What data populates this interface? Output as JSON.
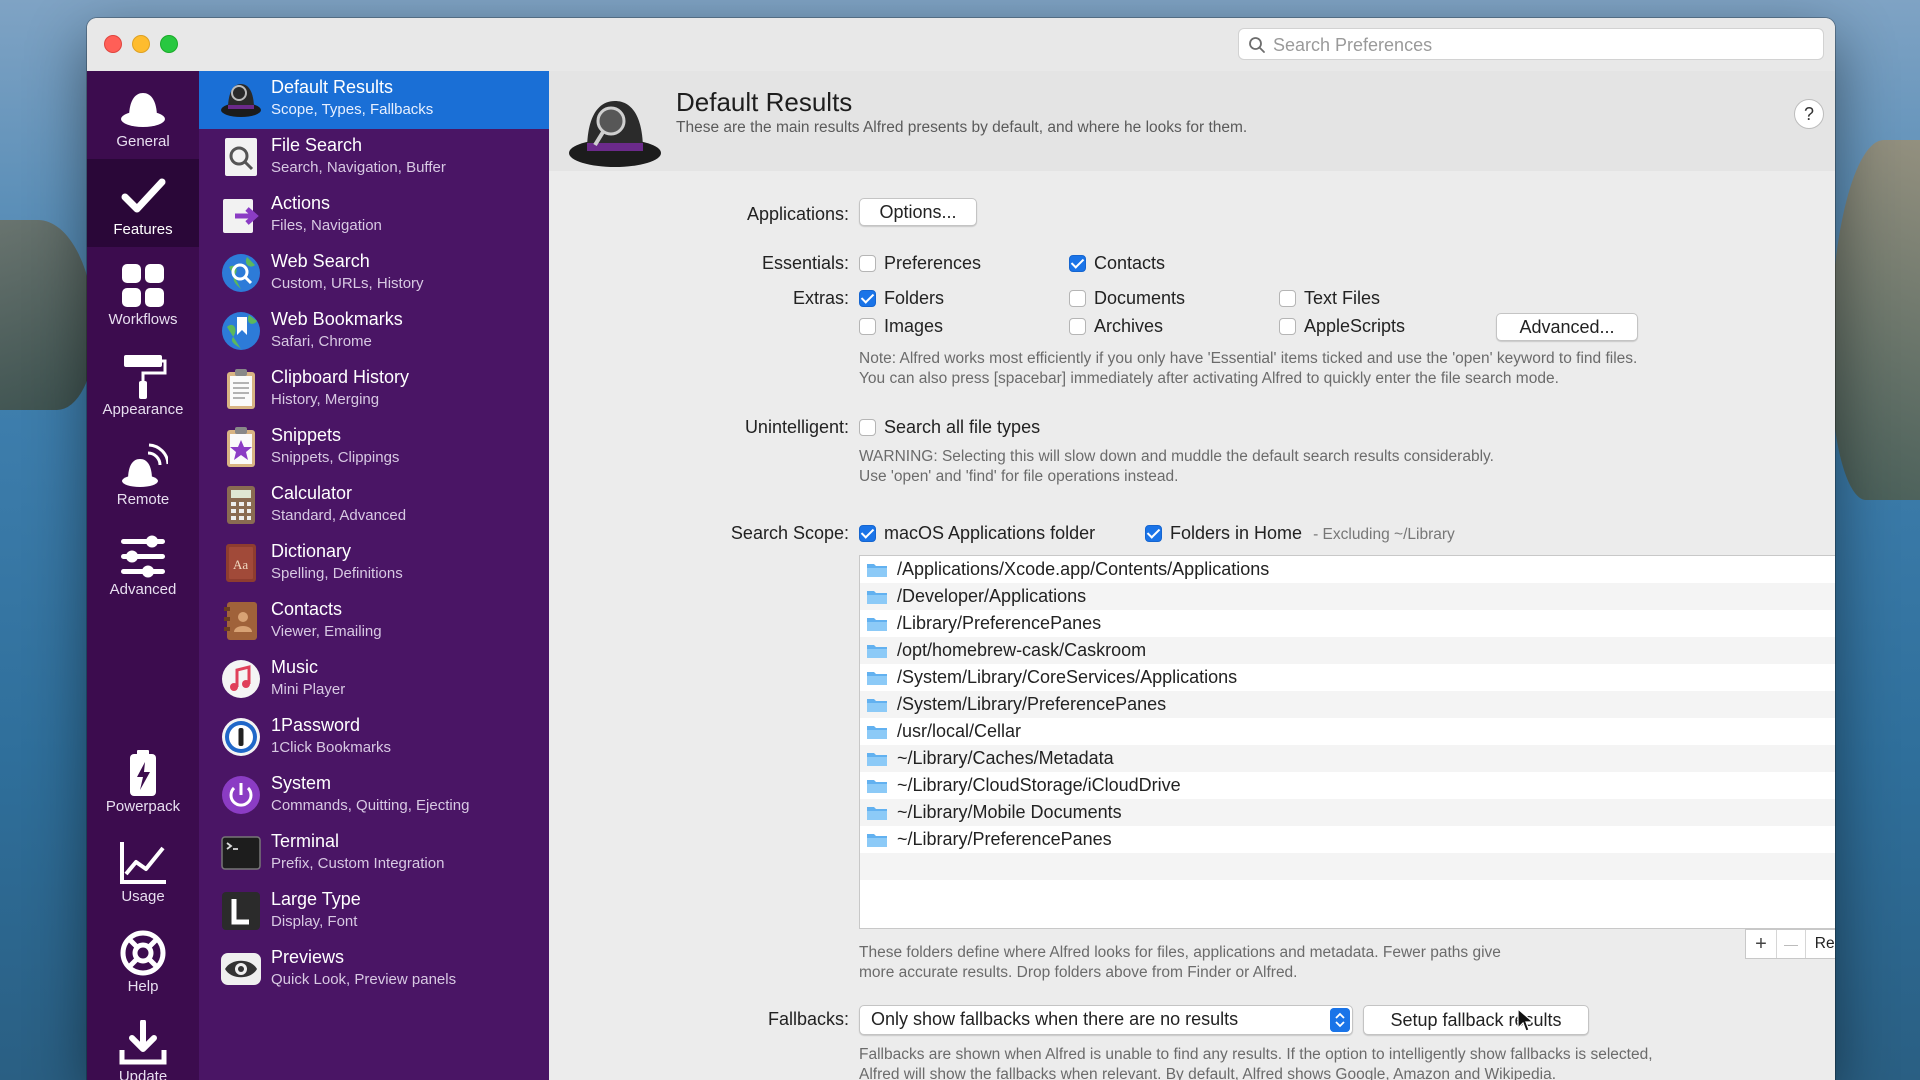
{
  "window": {
    "search_placeholder": "Search Preferences"
  },
  "iconbar": {
    "items": [
      {
        "label": "General",
        "icon": "hat-icon"
      },
      {
        "label": "Features",
        "icon": "checkmark-icon"
      },
      {
        "label": "Workflows",
        "icon": "grid-icon"
      },
      {
        "label": "Appearance",
        "icon": "paint-roller-icon"
      },
      {
        "label": "Remote",
        "icon": "remote-icon"
      },
      {
        "label": "Advanced",
        "icon": "sliders-icon"
      },
      {
        "label": "Powerpack",
        "icon": "powerpack-icon"
      },
      {
        "label": "Usage",
        "icon": "chart-icon"
      },
      {
        "label": "Help",
        "icon": "lifebuoy-icon"
      },
      {
        "label": "Update",
        "icon": "download-icon"
      }
    ]
  },
  "features": [
    {
      "title": "Default Results",
      "subtitle": "Scope, Types, Fallbacks"
    },
    {
      "title": "File Search",
      "subtitle": "Search, Navigation, Buffer"
    },
    {
      "title": "Actions",
      "subtitle": "Files, Navigation"
    },
    {
      "title": "Web Search",
      "subtitle": "Custom, URLs, History"
    },
    {
      "title": "Web Bookmarks",
      "subtitle": "Safari, Chrome"
    },
    {
      "title": "Clipboard History",
      "subtitle": "History, Merging"
    },
    {
      "title": "Snippets",
      "subtitle": "Snippets, Clippings"
    },
    {
      "title": "Calculator",
      "subtitle": "Standard, Advanced"
    },
    {
      "title": "Dictionary",
      "subtitle": "Spelling, Definitions"
    },
    {
      "title": "Contacts",
      "subtitle": "Viewer, Emailing"
    },
    {
      "title": "Music",
      "subtitle": "Mini Player"
    },
    {
      "title": "1Password",
      "subtitle": "1Click Bookmarks"
    },
    {
      "title": "System",
      "subtitle": "Commands, Quitting, Ejecting"
    },
    {
      "title": "Terminal",
      "subtitle": "Prefix, Custom Integration"
    },
    {
      "title": "Large Type",
      "subtitle": "Display, Font"
    },
    {
      "title": "Previews",
      "subtitle": "Quick Look, Preview panels"
    }
  ],
  "header": {
    "title": "Default Results",
    "subtitle": "These are the main results Alfred presents by default, and where he looks for them.",
    "help": "?"
  },
  "applications": {
    "label": "Applications:",
    "options_button": "Options..."
  },
  "essentials": {
    "label": "Essentials:",
    "preferences": "Preferences",
    "contacts": "Contacts"
  },
  "extras": {
    "label": "Extras:",
    "folders": "Folders",
    "documents": "Documents",
    "text_files": "Text Files",
    "images": "Images",
    "archives": "Archives",
    "applescripts": "AppleScripts",
    "advanced_button": "Advanced...",
    "note_line1": "Note: Alfred works most efficiently if you only have 'Essential' items ticked and use the 'open' keyword to find files.",
    "note_line2": "You can also press [spacebar] immediately after activating Alfred to quickly enter the file search mode."
  },
  "unintelligent": {
    "label": "Unintelligent:",
    "search_all": "Search all file types",
    "warning_line1": "WARNING: Selecting this will slow down and muddle the default search results considerably.",
    "warning_line2": "Use 'open' and 'find' for file operations instead."
  },
  "scope": {
    "label": "Search Scope:",
    "macos_apps": "macOS Applications folder",
    "folders_home": "Folders in Home",
    "excluding": "- Excluding ~/Library",
    "paths": [
      "/Applications/Xcode.app/Contents/Applications",
      "/Developer/Applications",
      "/Library/PreferencePanes",
      "/opt/homebrew-cask/Caskroom",
      "/System/Library/CoreServices/Applications",
      "/System/Library/PreferencePanes",
      "/usr/local/Cellar",
      "~/Library/Caches/Metadata",
      "~/Library/CloudStorage/iCloudDrive",
      "~/Library/Mobile Documents",
      "~/Library/PreferencePanes"
    ],
    "add": "+",
    "remove": "—",
    "reset": "Reset",
    "note_line1": "These folders define where Alfred looks for files, applications and metadata. Fewer paths give",
    "note_line2": "more accurate results. Drop folders above from Finder or Alfred."
  },
  "fallbacks": {
    "label": "Fallbacks:",
    "selected": "Only show fallbacks when there are no results",
    "setup_button": "Setup fallback results",
    "note_line1": "Fallbacks are shown when Alfred is unable to find any results. If the option to intelligently show fallbacks is selected,",
    "note_line2": "Alfred will show the fallbacks when relevant. By default, Alfred shows Google, Amazon and Wikipedia."
  },
  "checked": {
    "preferences": false,
    "contacts": true,
    "folders": true,
    "documents": false,
    "text_files": false,
    "images": false,
    "archives": false,
    "applescripts": false,
    "search_all": false,
    "macos_apps": true,
    "folders_home": true
  },
  "colors": {
    "selection": "#1a6fd6",
    "iconbar": "#3c0c4e",
    "featurelist": "#4a1565",
    "checkbox": "#1a74e8"
  }
}
